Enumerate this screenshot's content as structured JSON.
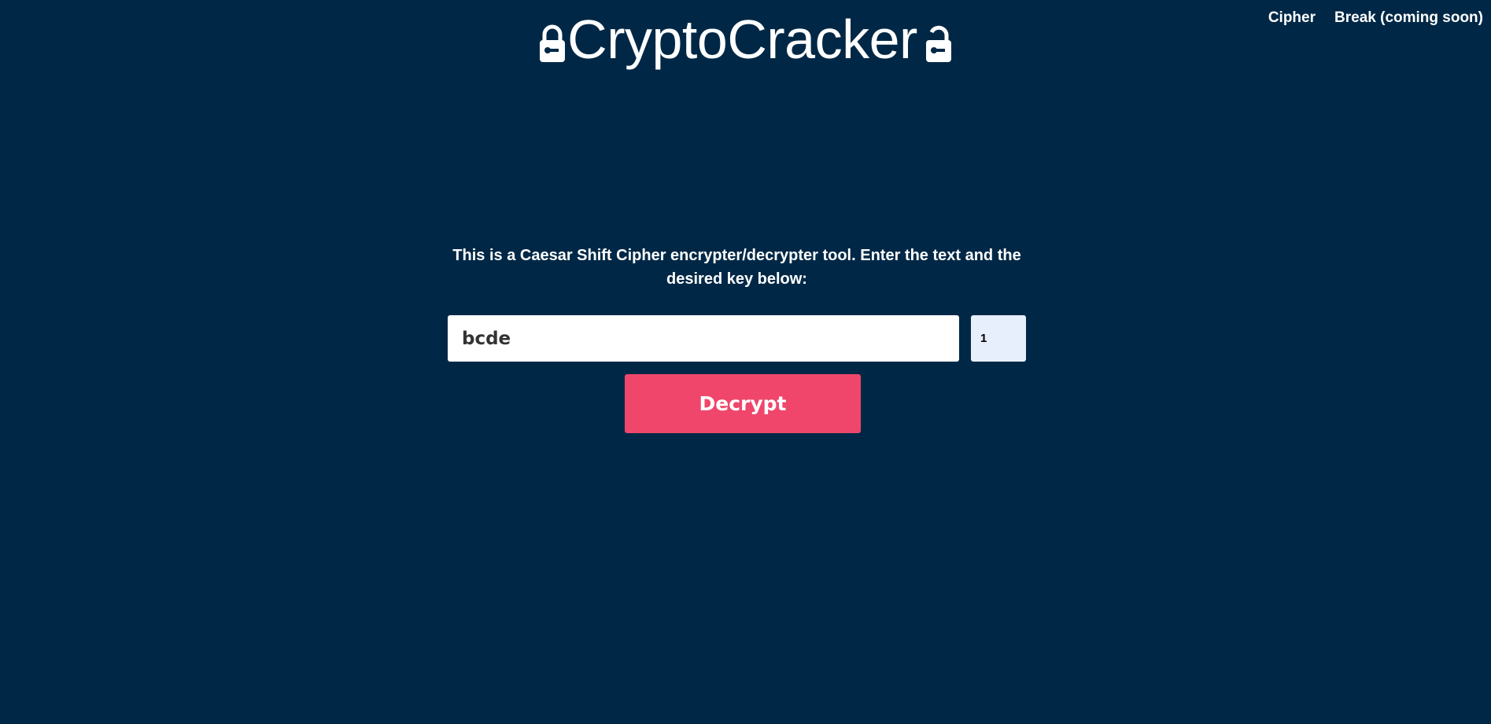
{
  "header": {
    "title": "CryptoCracker",
    "left_icon": "lock-closed-icon",
    "right_icon": "lock-open-icon"
  },
  "nav": {
    "items": [
      {
        "label": "Cipher"
      },
      {
        "label": "Break (coming soon)"
      }
    ]
  },
  "main": {
    "intro": "This is a Caesar Shift Cipher encrypter/decrypter tool. Enter the text and the desired key below:",
    "text_input": {
      "value": "bcde",
      "placeholder": ""
    },
    "key_input": {
      "value": "1"
    },
    "decrypt_label": "Decrypt"
  },
  "colors": {
    "background": "#002846",
    "button": "#f0466b",
    "key_input_bg": "#e8effc"
  }
}
